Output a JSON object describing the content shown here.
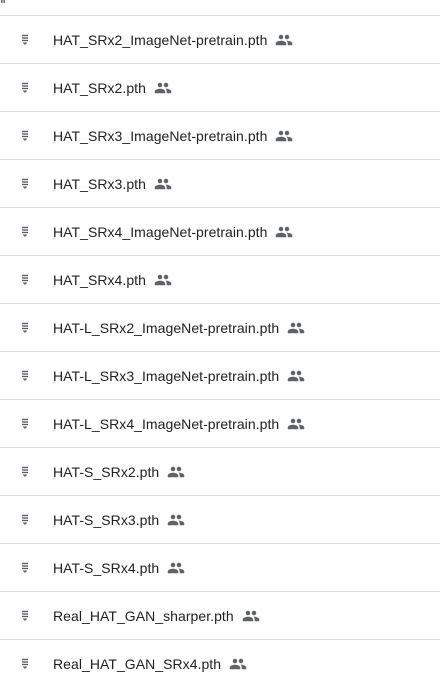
{
  "header": {
    "partial_text": "ⅱ   "
  },
  "files": [
    {
      "name": "HAT_SRx2_ImageNet-pretrain.pth",
      "icon": "file-icon",
      "badge": "shared-icon"
    },
    {
      "name": "HAT_SRx2.pth",
      "icon": "file-icon",
      "badge": "shared-icon"
    },
    {
      "name": "HAT_SRx3_ImageNet-pretrain.pth",
      "icon": "file-icon",
      "badge": "shared-icon"
    },
    {
      "name": "HAT_SRx3.pth",
      "icon": "file-icon",
      "badge": "shared-icon"
    },
    {
      "name": "HAT_SRx4_ImageNet-pretrain.pth",
      "icon": "file-icon",
      "badge": "shared-icon"
    },
    {
      "name": "HAT_SRx4.pth",
      "icon": "file-icon",
      "badge": "shared-icon"
    },
    {
      "name": "HAT-L_SRx2_ImageNet-pretrain.pth",
      "icon": "file-icon",
      "badge": "shared-icon"
    },
    {
      "name": "HAT-L_SRx3_ImageNet-pretrain.pth",
      "icon": "file-icon",
      "badge": "shared-icon"
    },
    {
      "name": "HAT-L_SRx4_ImageNet-pretrain.pth",
      "icon": "file-icon",
      "badge": "shared-icon"
    },
    {
      "name": "HAT-S_SRx2.pth",
      "icon": "file-icon",
      "badge": "shared-icon"
    },
    {
      "name": "HAT-S_SRx3.pth",
      "icon": "file-icon",
      "badge": "shared-icon"
    },
    {
      "name": "HAT-S_SRx4.pth",
      "icon": "file-icon",
      "badge": "shared-icon"
    },
    {
      "name": "Real_HAT_GAN_sharper.pth",
      "icon": "file-icon",
      "badge": "shared-icon"
    },
    {
      "name": "Real_HAT_GAN_SRx4.pth",
      "icon": "file-icon",
      "badge": "shared-icon"
    }
  ],
  "colors": {
    "text": "#202124",
    "icon": "#5f6368",
    "divider": "#dadce0",
    "background": "#ffffff"
  }
}
